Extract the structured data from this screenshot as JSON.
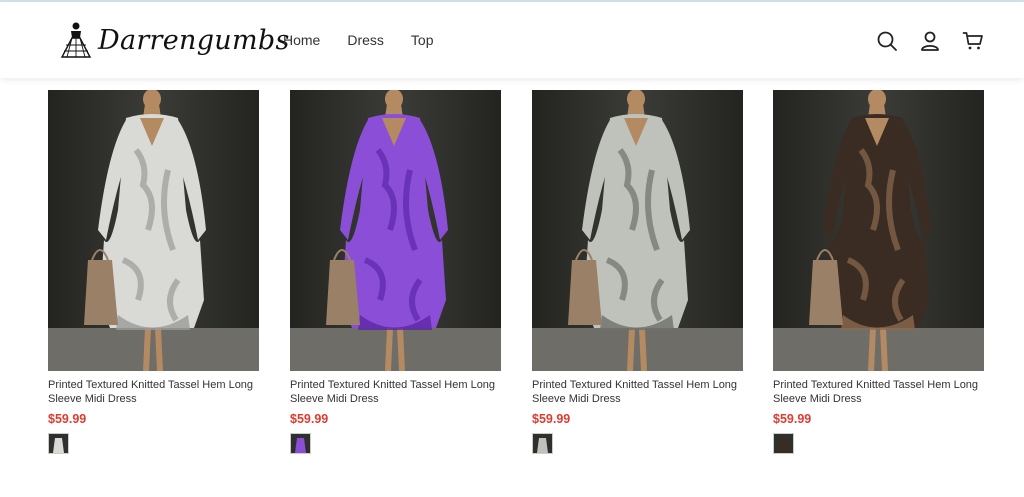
{
  "brand": {
    "name": "Darrengumbs"
  },
  "nav": [
    "Home",
    "Dress",
    "Top"
  ],
  "header_icons": [
    "search-icon",
    "user-icon",
    "cart-icon"
  ],
  "products": [
    {
      "title": "Printed Textured Knitted Tassel Hem Long Sleeve Midi Dress",
      "price": "$59.99",
      "color_name": "white-marble",
      "color": "#d9d9d6",
      "accent": "#9a9a97"
    },
    {
      "title": "Printed Textured Knitted Tassel Hem Long Sleeve Midi Dress",
      "price": "$59.99",
      "color_name": "purple-camo",
      "color": "#8a4fd6",
      "accent": "#5d27a8"
    },
    {
      "title": "Printed Textured Knitted Tassel Hem Long Sleeve Midi Dress",
      "price": "$59.99",
      "color_name": "grey-camo",
      "color": "#bfc1bb",
      "accent": "#6e706b"
    },
    {
      "title": "Printed Textured Knitted Tassel Hem Long Sleeve Midi Dress",
      "price": "$59.99",
      "color_name": "leopard",
      "color": "#3a2c22",
      "accent": "#8b6a4d"
    }
  ],
  "colors": {
    "price": "#e03b2e",
    "header_border": "#cfe3ea"
  }
}
